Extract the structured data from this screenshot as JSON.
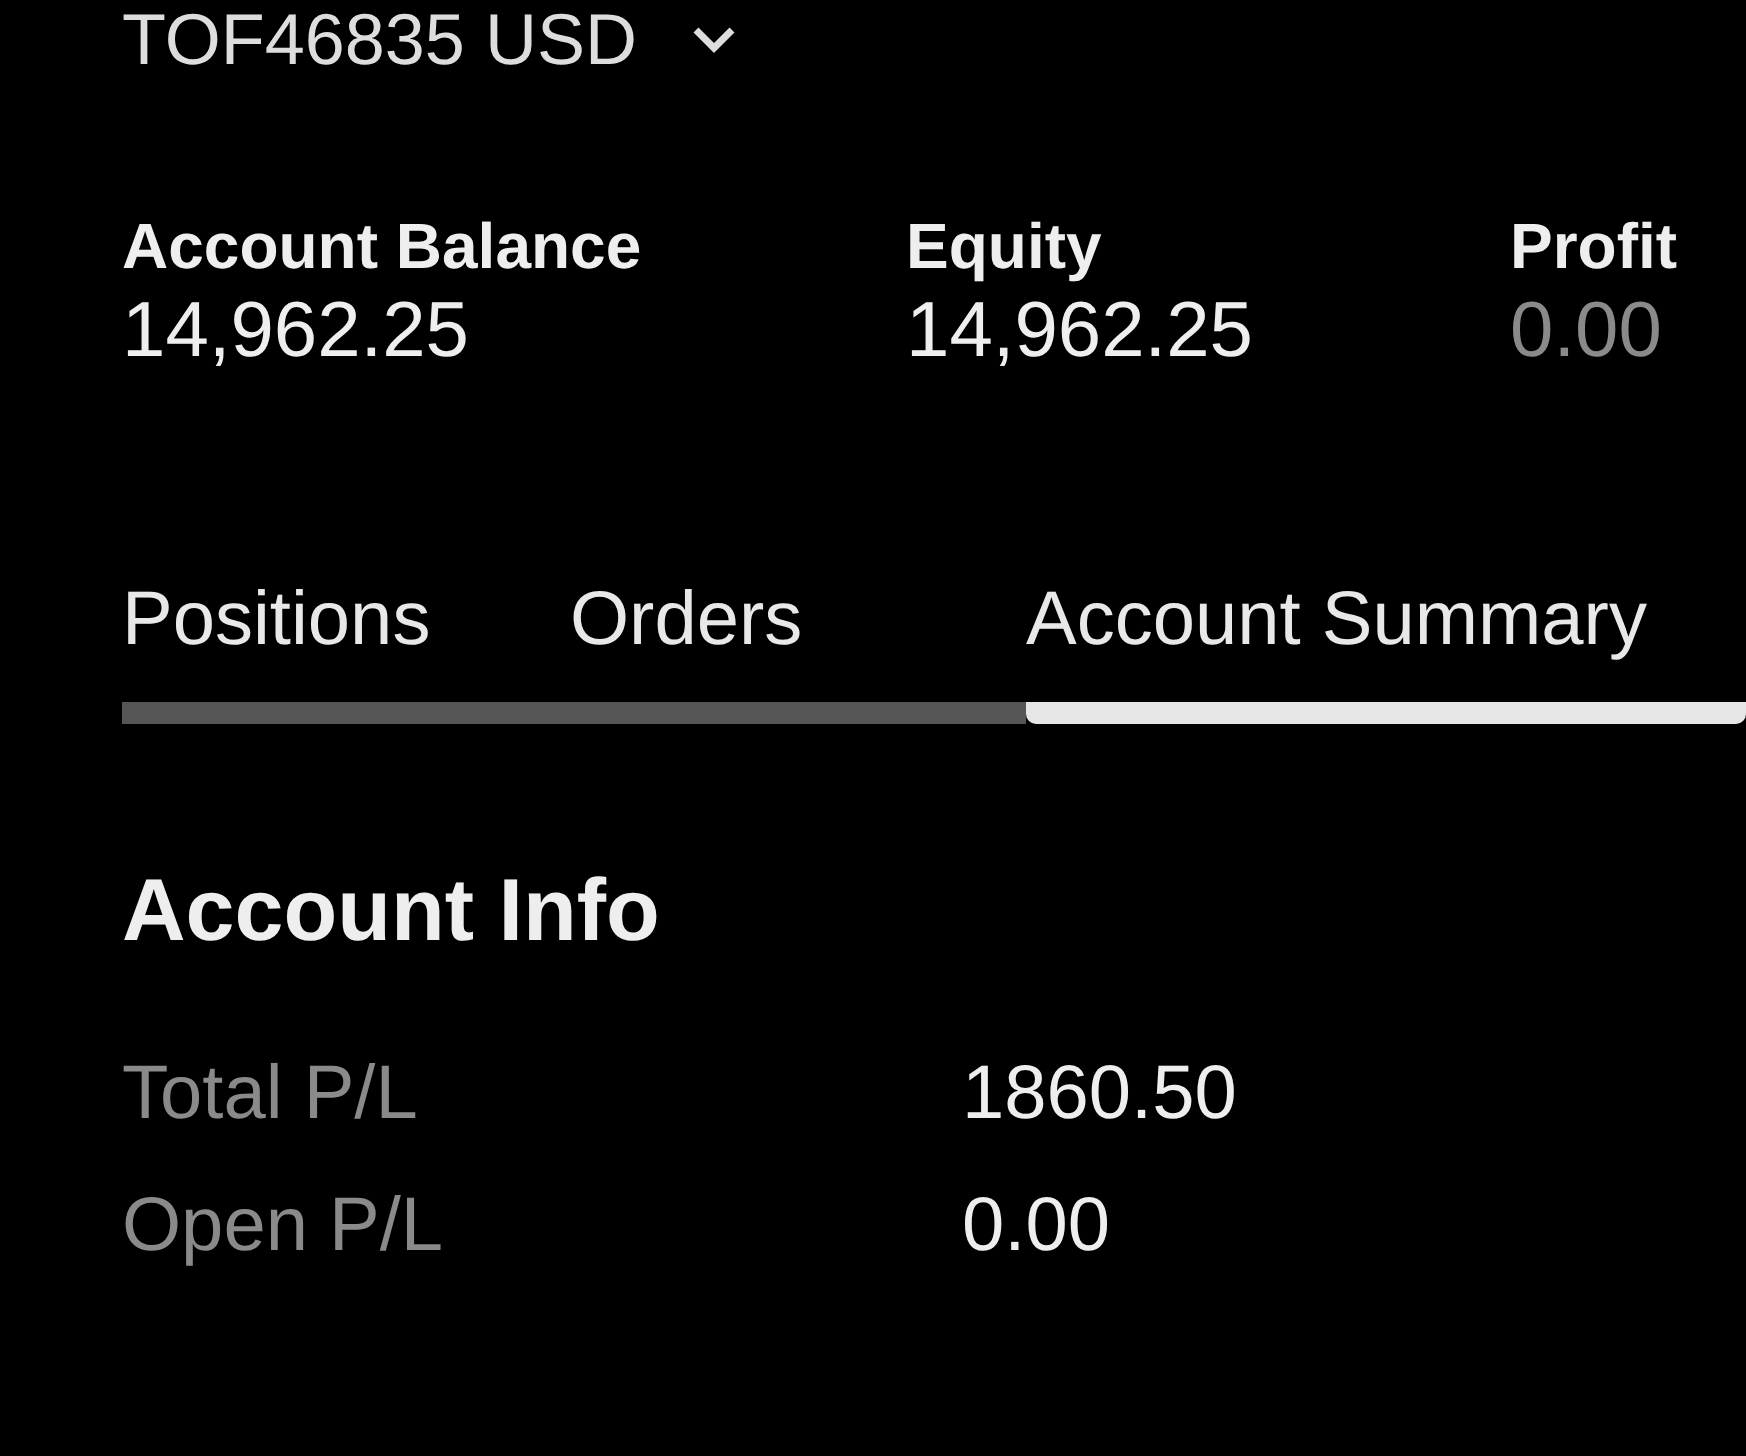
{
  "account_selector": {
    "label": "TOF46835 USD"
  },
  "stats": [
    {
      "label": "Account Balance",
      "value": "14,962.25",
      "dimmed": false
    },
    {
      "label": "Equity",
      "value": "14,962.25",
      "dimmed": false
    },
    {
      "label": "Profit",
      "value": "0.00",
      "dimmed": true
    }
  ],
  "tabs": [
    {
      "label": "Positions",
      "selected": false
    },
    {
      "label": "Orders",
      "selected": false
    },
    {
      "label": "Account Summary",
      "selected": true
    }
  ],
  "section": {
    "title": "Account Info",
    "rows": [
      {
        "label": "Total P/L",
        "value": "1860.50"
      },
      {
        "label": "Open P/L",
        "value": "0.00"
      }
    ]
  }
}
